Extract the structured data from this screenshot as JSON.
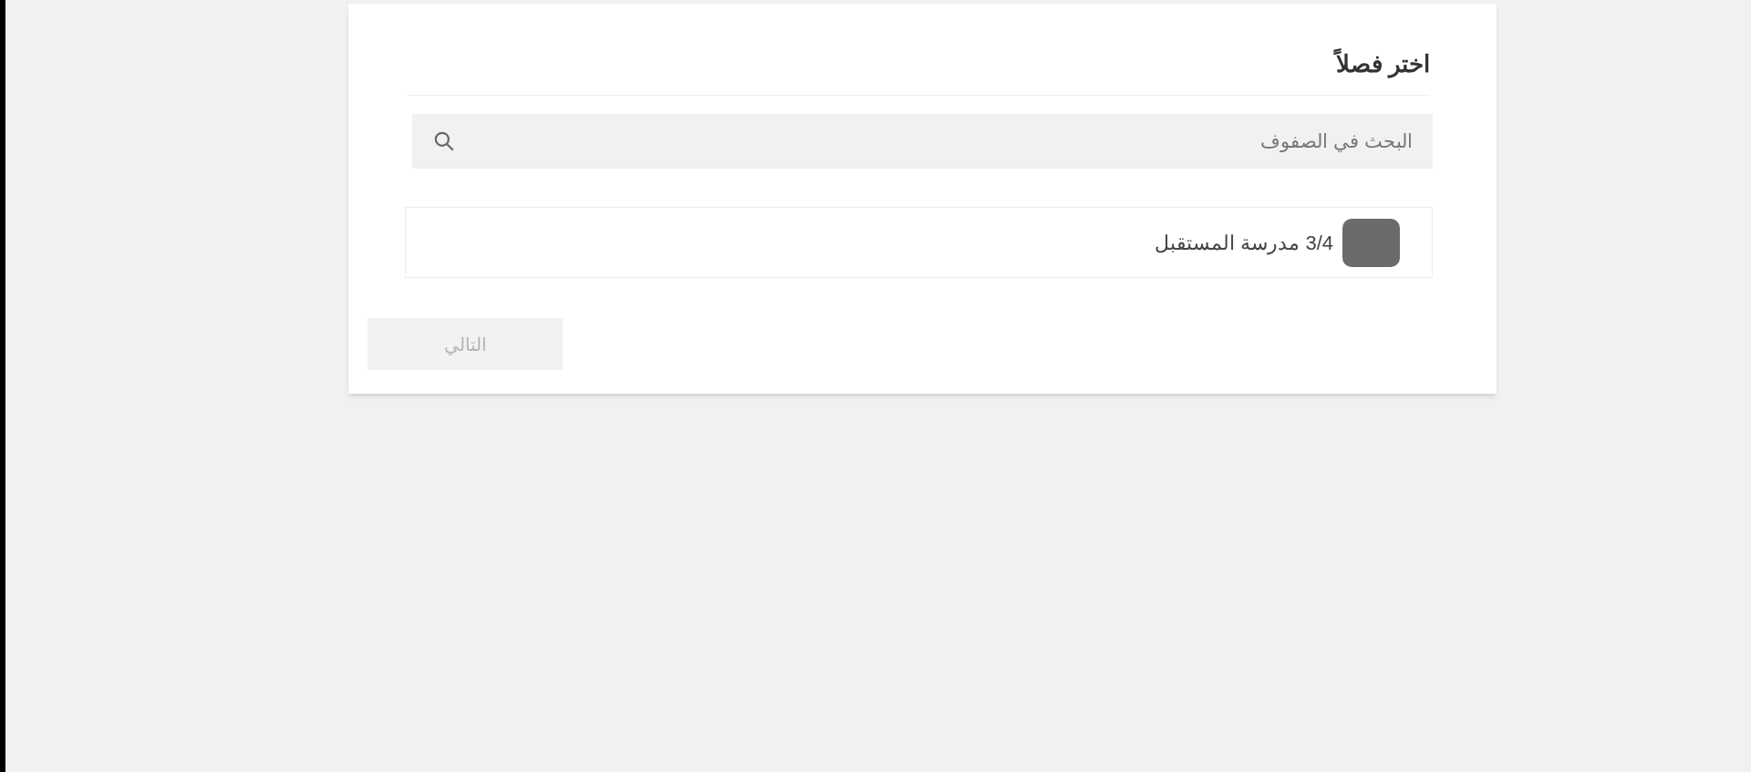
{
  "dialog": {
    "title": "اختر فصلاً"
  },
  "search": {
    "placeholder": "البحث في الصفوف"
  },
  "classes": [
    {
      "label": "3/4 مدرسة المستقبل",
      "color": "#6b6b6b",
      "selected": false
    }
  ],
  "next_button": {
    "label": "التالي",
    "disabled": true
  }
}
